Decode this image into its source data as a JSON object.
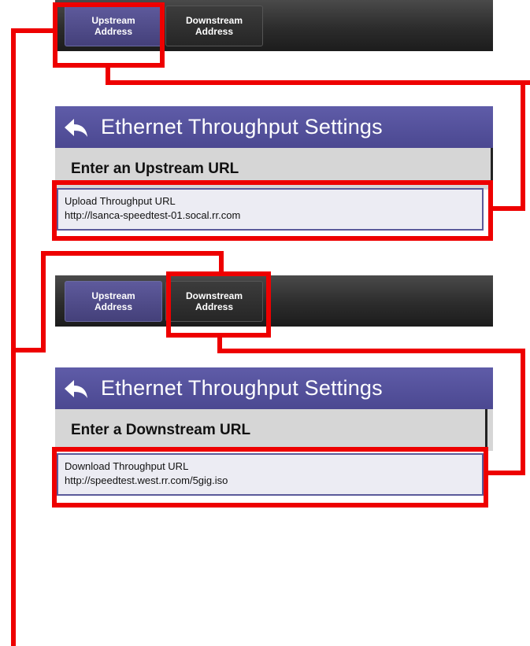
{
  "tabs": {
    "upstream_label": "Upstream\nAddress",
    "downstream_label": "Downstream\nAddress"
  },
  "upstream_panel": {
    "title": "Ethernet Throughput Settings",
    "subtitle": "Enter an Upstream URL",
    "field_label": "Upload Throughput URL",
    "field_value": "http://lsanca-speedtest-01.socal.rr.com"
  },
  "downstream_panel": {
    "title": "Ethernet Throughput Settings",
    "subtitle": "Enter a Downstream URL",
    "field_label": "Download Throughput URL",
    "field_value": "http://speedtest.west.rr.com/5gig.iso"
  },
  "colors": {
    "annotation": "#ee0000",
    "header": "#5554a0",
    "selected_tab": "#4f4b8a"
  },
  "icons": [
    "back-arrow-icon"
  ]
}
